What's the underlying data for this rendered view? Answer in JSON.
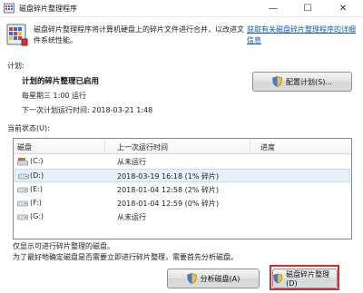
{
  "window": {
    "title": "磁盘碎片整理程序",
    "minimize": "—",
    "maximize": "☐",
    "close": "✕"
  },
  "header": {
    "description": "磁盘碎片整理程序将计算机硬盘上的碎片文件进行合并，以改进文件系统性能。",
    "help_link": "获取有关磁盘碎片整理程序的详细信息"
  },
  "schedule": {
    "section_label": "计划:",
    "status": "计划的碎片整理已启用",
    "frequency": "每星期三 1:00 运行",
    "next_run": "下一次计划运行时间: 2018-03-21 1:48",
    "configure_button": "配置计划(S)..."
  },
  "current_status": {
    "section_label": "当前状态(U):",
    "columns": [
      "磁盘",
      "上一次运行时间",
      "进度"
    ],
    "rows": [
      {
        "disk": "(C:)",
        "last_run": "从未运行",
        "progress": ""
      },
      {
        "disk": "(D:)",
        "last_run": "2018-03-19 16:18 (1% 碎片)",
        "progress": ""
      },
      {
        "disk": "(E:)",
        "last_run": "2018-01-04 12:58 (2% 碎片)",
        "progress": ""
      },
      {
        "disk": "(F:)",
        "last_run": "2018-01-04 12:59 (0% 碎片)",
        "progress": ""
      },
      {
        "disk": "(G:)",
        "last_run": "从未运行",
        "progress": ""
      }
    ]
  },
  "notes": {
    "line1": "仅显示可进行碎片整理的磁盘。",
    "line2": "为了最好地确定磁盘是否需要立即进行碎片整理，需要首先分析磁盘。"
  },
  "actions": {
    "analyze_button": "分析磁盘(A)",
    "defrag_button": "磁盘碎片整理(D)"
  },
  "colors": {
    "link": "#0b59c7",
    "highlight_box": "#d82b2b",
    "selected_row": "#e5f0fb"
  }
}
